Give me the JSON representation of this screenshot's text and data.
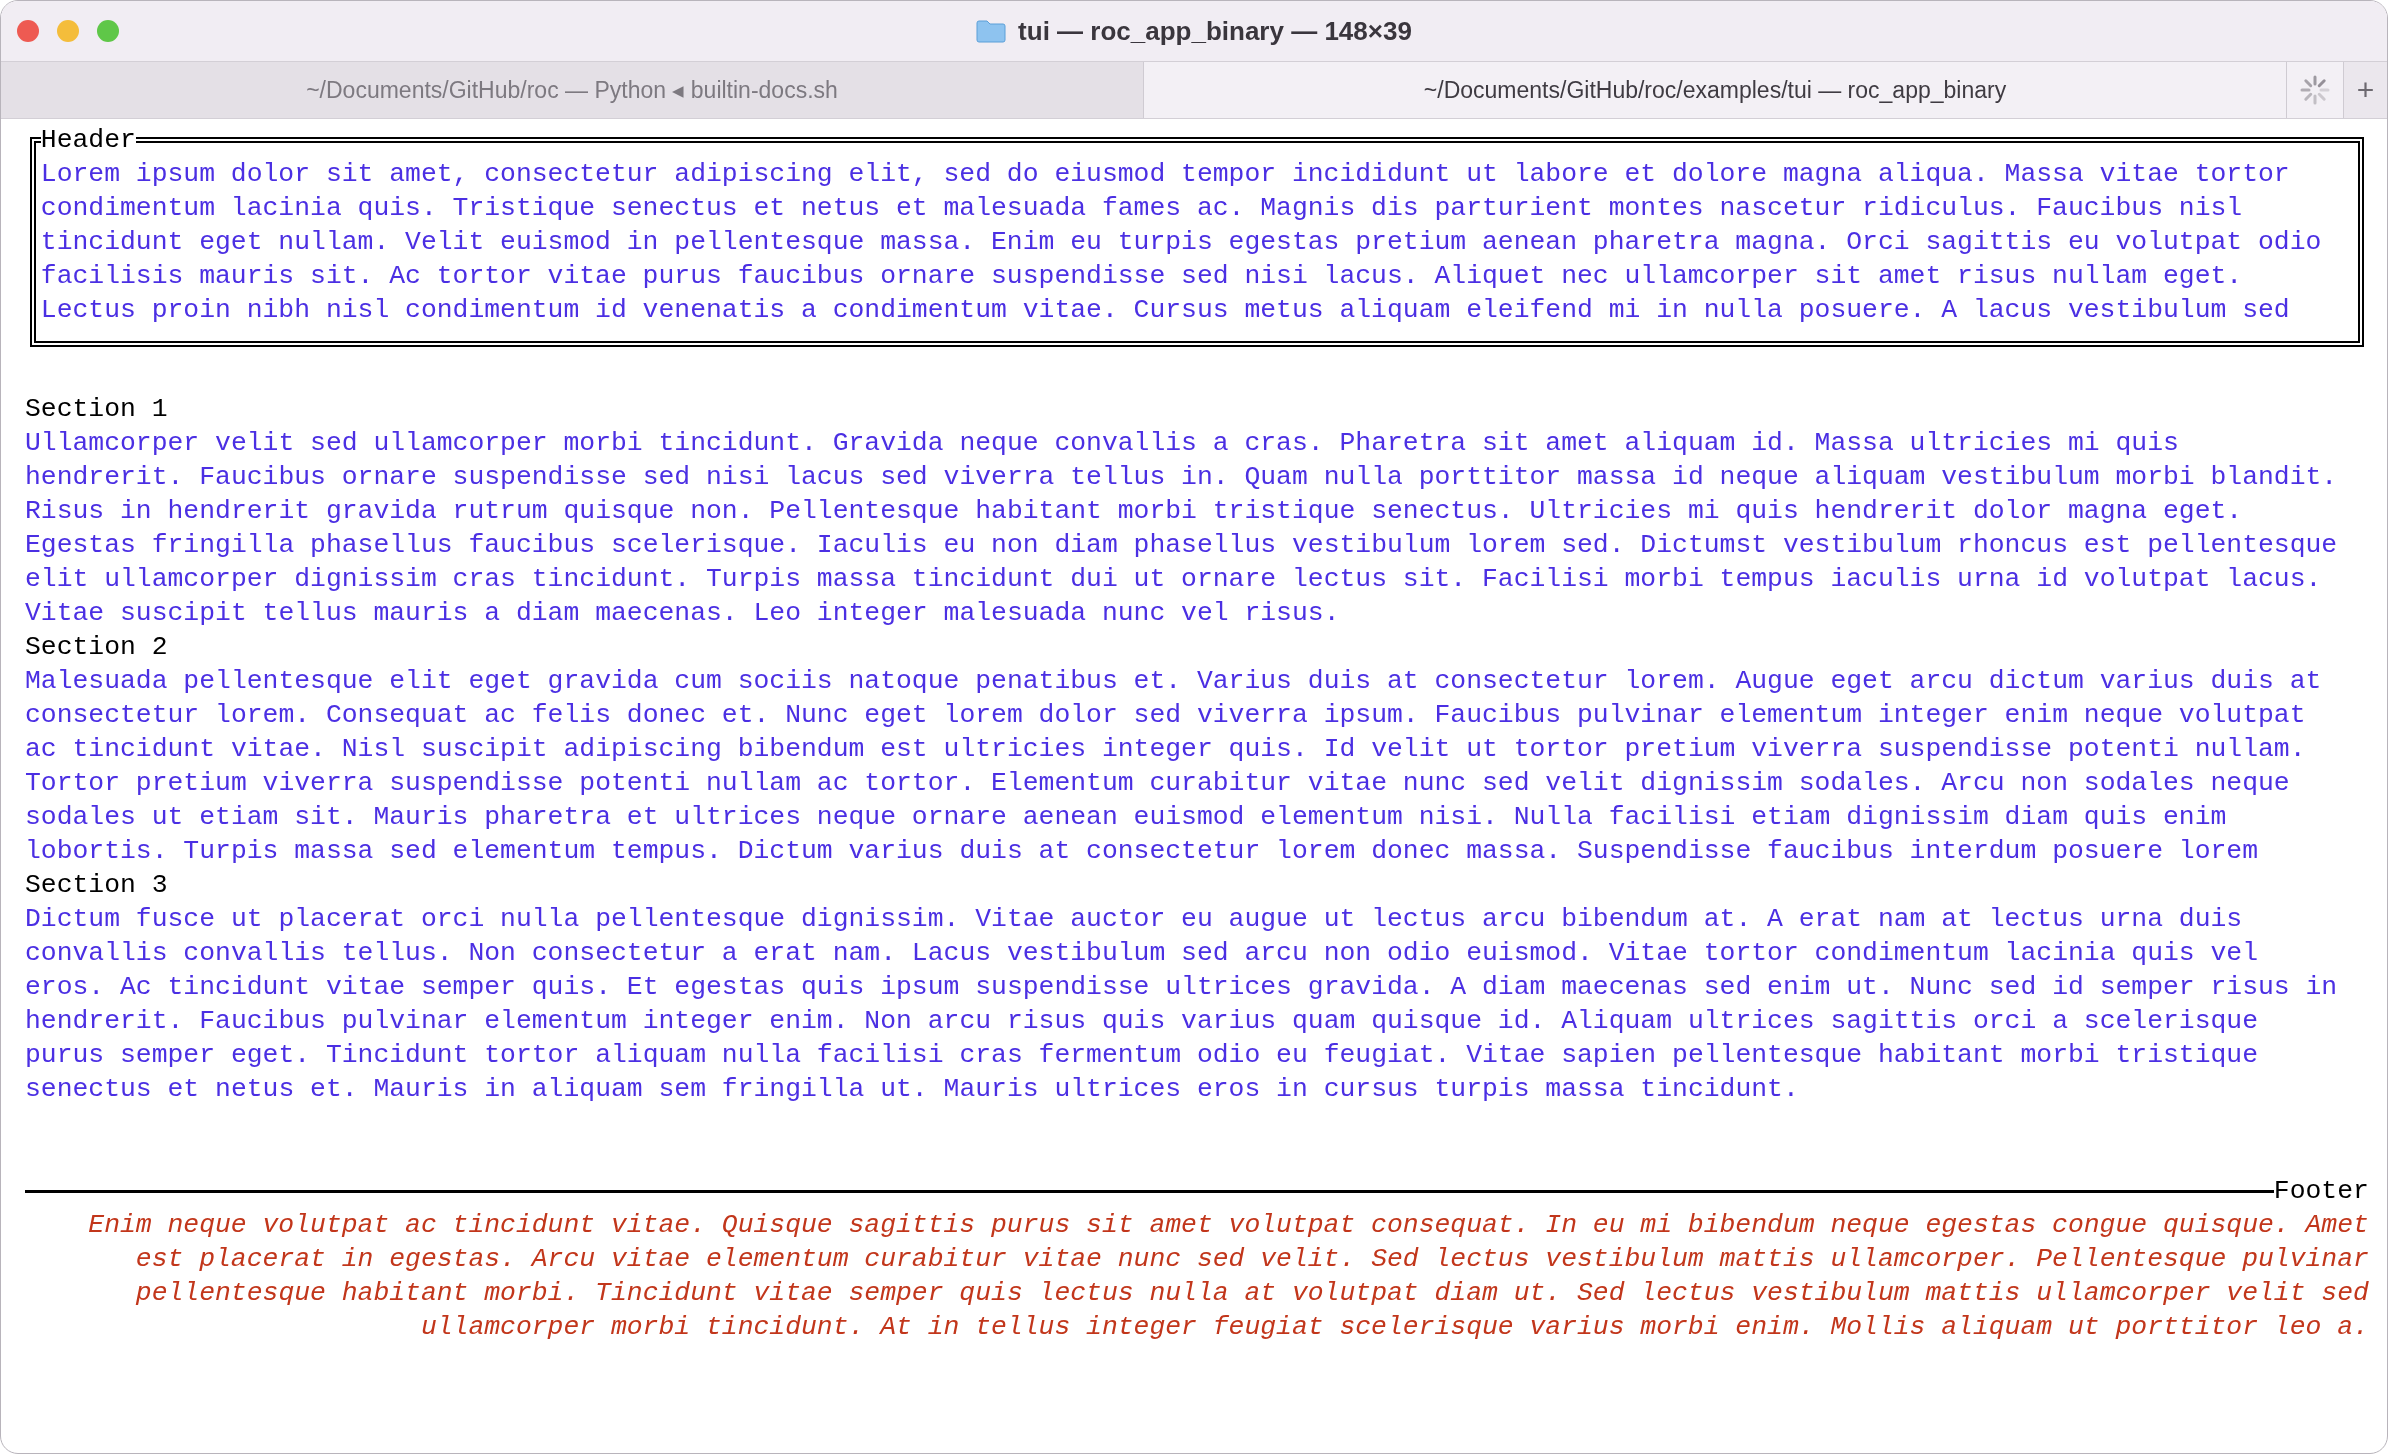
{
  "window": {
    "title": "tui — roc_app_binary — 148×39"
  },
  "tabs": [
    {
      "label": "~/Documents/GitHub/roc — Python ◂ builtin-docs.sh",
      "selected": false
    },
    {
      "label": "~/Documents/GitHub/roc/examples/tui — roc_app_binary",
      "selected": true
    }
  ],
  "new_tab": "+",
  "header": {
    "title": "Header",
    "lines": [
      "Lorem ipsum dolor sit amet, consectetur adipiscing elit, sed do eiusmod tempor incididunt ut labore et dolore magna aliqua. Massa vitae tortor",
      "condimentum lacinia quis. Tristique senectus et netus et malesuada fames ac. Magnis dis parturient montes nascetur ridiculus. Faucibus nisl",
      "tincidunt eget nullam. Velit euismod in pellentesque massa. Enim eu turpis egestas pretium aenean pharetra magna. Orci sagittis eu volutpat odio",
      "facilisis mauris sit. Ac tortor vitae purus faucibus ornare suspendisse sed nisi lacus. Aliquet nec ullamcorper sit amet risus nullam eget.",
      "Lectus proin nibh nisl condimentum id venenatis a condimentum vitae. Cursus metus aliquam eleifend mi in nulla posuere. A lacus vestibulum sed"
    ]
  },
  "sections": [
    {
      "title": "Section 1",
      "lines": [
        "Ullamcorper velit sed ullamcorper morbi tincidunt. Gravida neque convallis a cras. Pharetra sit amet aliquam id. Massa ultricies mi quis",
        "hendrerit. Faucibus ornare suspendisse sed nisi lacus sed viverra tellus in. Quam nulla porttitor massa id neque aliquam vestibulum morbi blandit.",
        "Risus in hendrerit gravida rutrum quisque non. Pellentesque habitant morbi tristique senectus. Ultricies mi quis hendrerit dolor magna eget.",
        "Egestas fringilla phasellus faucibus scelerisque. Iaculis eu non diam phasellus vestibulum lorem sed. Dictumst vestibulum rhoncus est pellentesque",
        "elit ullamcorper dignissim cras tincidunt. Turpis massa tincidunt dui ut ornare lectus sit. Facilisi morbi tempus iaculis urna id volutpat lacus.",
        "Vitae suscipit tellus mauris a diam maecenas. Leo integer malesuada nunc vel risus."
      ]
    },
    {
      "title": "Section 2",
      "lines": [
        "Malesuada pellentesque elit eget gravida cum sociis natoque penatibus et. Varius duis at consectetur lorem. Augue eget arcu dictum varius duis at",
        "consectetur lorem. Consequat ac felis donec et. Nunc eget lorem dolor sed viverra ipsum. Faucibus pulvinar elementum integer enim neque volutpat",
        "ac tincidunt vitae. Nisl suscipit adipiscing bibendum est ultricies integer quis. Id velit ut tortor pretium viverra suspendisse potenti nullam.",
        "Tortor pretium viverra suspendisse potenti nullam ac tortor. Elementum curabitur vitae nunc sed velit dignissim sodales. Arcu non sodales neque",
        "sodales ut etiam sit. Mauris pharetra et ultrices neque ornare aenean euismod elementum nisi. Nulla facilisi etiam dignissim diam quis enim",
        "lobortis. Turpis massa sed elementum tempus. Dictum varius duis at consectetur lorem donec massa. Suspendisse faucibus interdum posuere lorem"
      ]
    },
    {
      "title": "Section 3",
      "lines": [
        "Dictum fusce ut placerat orci nulla pellentesque dignissim. Vitae auctor eu augue ut lectus arcu bibendum at. A erat nam at lectus urna duis",
        "convallis convallis tellus. Non consectetur a erat nam. Lacus vestibulum sed arcu non odio euismod. Vitae tortor condimentum lacinia quis vel",
        "eros. Ac tincidunt vitae semper quis. Et egestas quis ipsum suspendisse ultrices gravida. A diam maecenas sed enim ut. Nunc sed id semper risus in",
        "hendrerit. Faucibus pulvinar elementum integer enim. Non arcu risus quis varius quam quisque id. Aliquam ultrices sagittis orci a scelerisque",
        "purus semper eget. Tincidunt tortor aliquam nulla facilisi cras fermentum odio eu feugiat. Vitae sapien pellentesque habitant morbi tristique",
        "senectus et netus et. Mauris in aliquam sem fringilla ut. Mauris ultrices eros in cursus turpis massa tincidunt."
      ]
    }
  ],
  "footer": {
    "title": "Footer",
    "lines": [
      "Enim neque volutpat ac tincidunt vitae. Quisque sagittis purus sit amet volutpat consequat. In eu mi bibendum neque egestas congue quisque. Amet",
      "est placerat in egestas. Arcu vitae elementum curabitur vitae nunc sed velit. Sed lectus vestibulum mattis ullamcorper. Pellentesque pulvinar",
      "pellentesque habitant morbi. Tincidunt vitae semper quis lectus nulla at volutpat diam ut. Sed lectus vestibulum mattis ullamcorper velit sed",
      "ullamcorper morbi tincidunt. At in tellus integer feugiat scelerisque varius morbi enim. Mollis aliquam ut porttitor leo a."
    ]
  }
}
